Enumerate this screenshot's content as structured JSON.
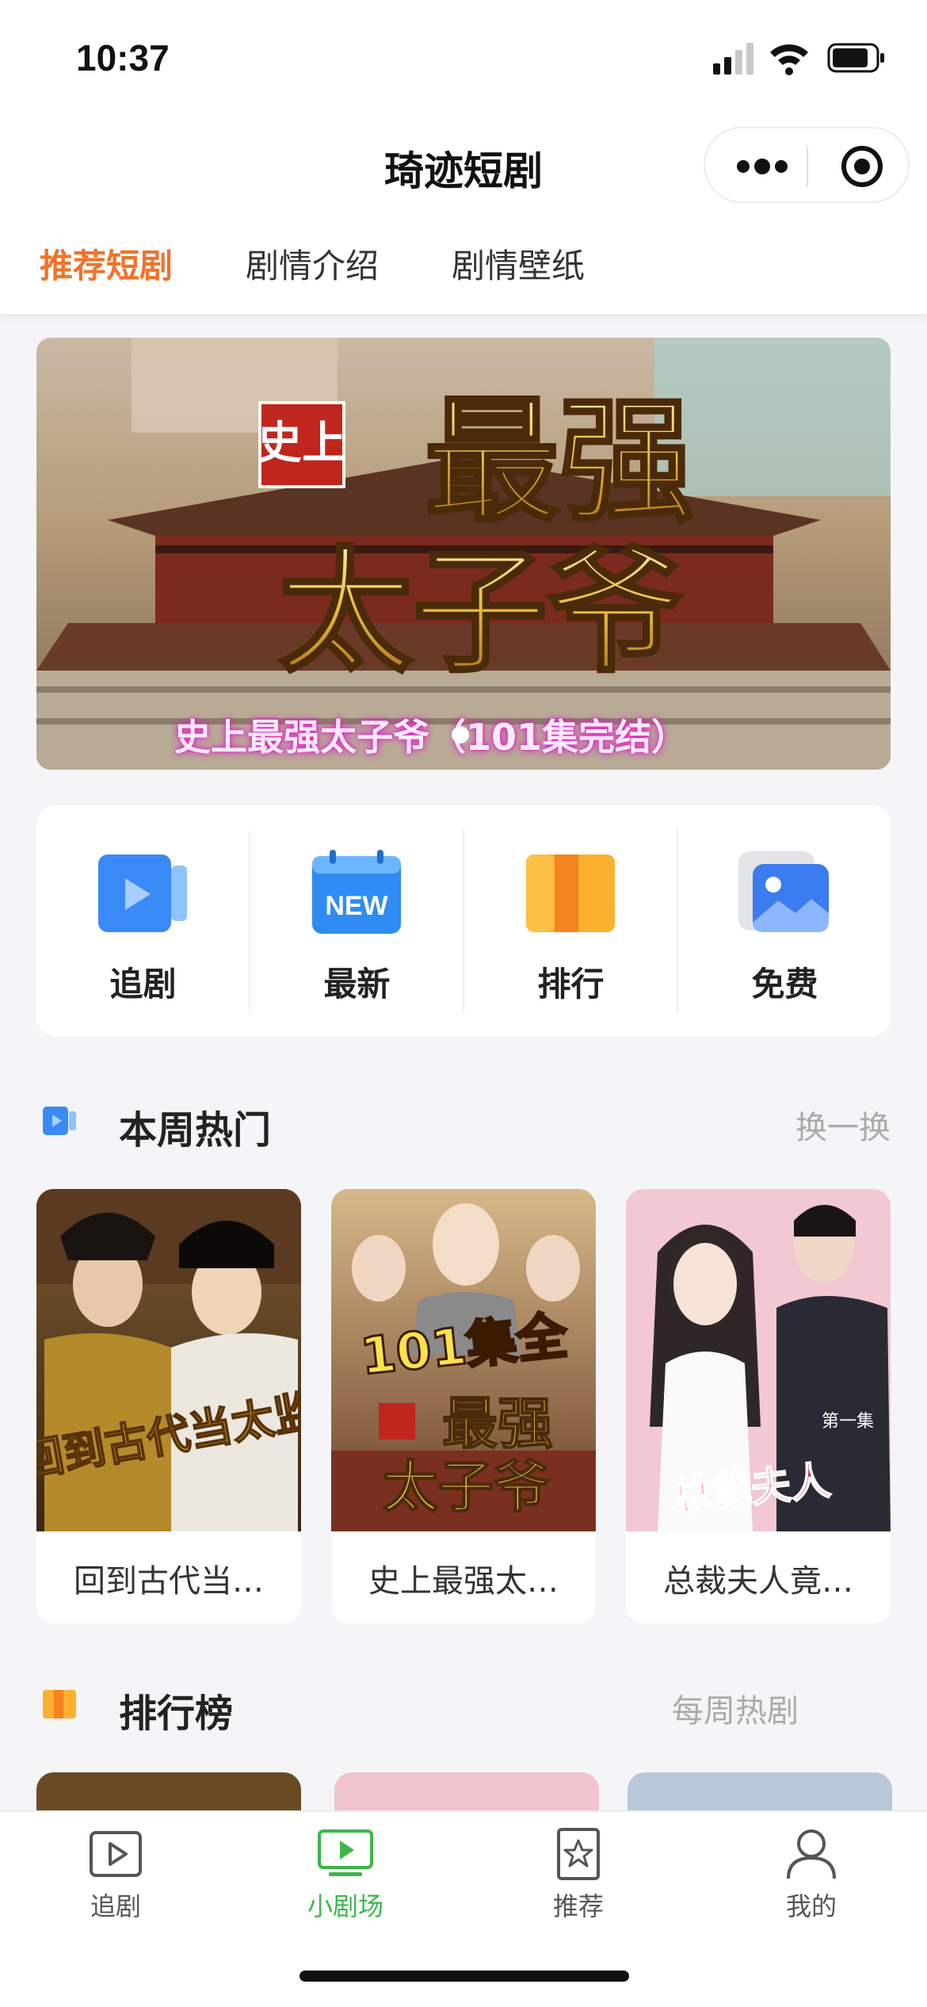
{
  "status_bar": {
    "time": "10:37"
  },
  "nav": {
    "title": "琦迹短剧"
  },
  "tabs": [
    {
      "label": "推荐短剧",
      "active": true
    },
    {
      "label": "剧情介绍",
      "active": false
    },
    {
      "label": "剧情壁纸",
      "active": false
    }
  ],
  "banner": {
    "caption": "史上最强太子爷（101集完结）",
    "art_text": {
      "seal": "史上",
      "line1": "最强",
      "line2": "太子爷"
    }
  },
  "quick_menu": [
    {
      "label": "追剧",
      "icon": "play-video-icon"
    },
    {
      "label": "最新",
      "icon": "new-calendar-icon",
      "badge": "NEW"
    },
    {
      "label": "排行",
      "icon": "rank-book-icon"
    },
    {
      "label": "免费",
      "icon": "photo-gallery-icon"
    }
  ],
  "weekly_hot": {
    "title": "本周热门",
    "action": "换一换",
    "items": [
      {
        "title": "回到古代当…",
        "poster_text": "回到古代当太监"
      },
      {
        "title": "史上最强太…",
        "poster_text": "101集全"
      },
      {
        "title": "总裁夫人竟…",
        "poster_text": "总裁夫人",
        "episode_tag": "第一集"
      }
    ]
  },
  "ranking": {
    "title": "排行榜",
    "action": "每周热剧"
  },
  "tabbar": [
    {
      "label": "追剧",
      "icon": "play-box-icon",
      "active": false
    },
    {
      "label": "小剧场",
      "icon": "tv-icon",
      "active": true
    },
    {
      "label": "推荐",
      "icon": "star-bookmark-icon",
      "active": false
    },
    {
      "label": "我的",
      "icon": "person-icon",
      "active": false
    }
  ],
  "colors": {
    "accent": "#f0732a",
    "tab_active": "#3cb64a",
    "link": "#aaaaaa"
  }
}
